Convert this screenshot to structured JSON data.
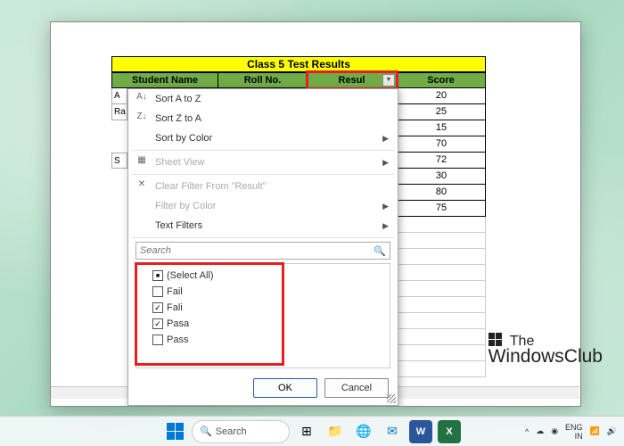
{
  "sheet": {
    "title": "Class 5 Test Results",
    "headers": {
      "student": "Student Name",
      "roll": "Roll No.",
      "result": "Resul",
      "score": "Score"
    },
    "partial_col": [
      "A",
      "Ra",
      "",
      "S"
    ],
    "scores": [
      "20",
      "25",
      "15",
      "70",
      "72",
      "30",
      "80",
      "75"
    ]
  },
  "filter": {
    "sort_az": "Sort A to Z",
    "sort_za": "Sort Z to A",
    "sort_color": "Sort by Color",
    "sheet_view": "Sheet View",
    "clear": "Clear Filter From \"Result\"",
    "filter_color": "Filter by Color",
    "text_filters": "Text Filters",
    "search_placeholder": "Search",
    "items": [
      {
        "label": "(Select All)",
        "state": "mixed"
      },
      {
        "label": "Fail",
        "state": ""
      },
      {
        "label": "Fali",
        "state": "checked"
      },
      {
        "label": "Pasa",
        "state": "checked"
      },
      {
        "label": "Pass",
        "state": ""
      }
    ],
    "ok": "OK",
    "cancel": "Cancel"
  },
  "watermark": {
    "line1": "The",
    "line2": "WindowsClub"
  },
  "taskbar": {
    "search": "Search",
    "lang": "ENG",
    "region": "IN"
  }
}
